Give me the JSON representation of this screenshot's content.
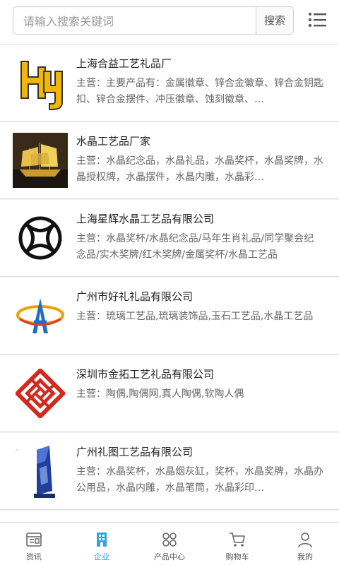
{
  "search": {
    "placeholder": "请输入搜索关键词",
    "button_label": "搜索"
  },
  "companies": [
    {
      "name": "上海合益工艺礼品厂",
      "desc": "主营：主要产品有：金属徽章、锌合金徽章、锌合金钥匙扣、锌合金摆件、冲压徽章、蚀刻徽章、…"
    },
    {
      "name": "水晶工艺品厂家",
      "desc": "主营：水晶纪念品，水晶礼品，水晶奖杯，水晶奖牌，水晶授权牌，水晶摆件，水晶内雕，水晶彩…"
    },
    {
      "name": "上海星辉水晶工艺品有限公司",
      "desc": "主营：水晶奖杯/水晶纪念品/马年生肖礼品/同学聚会纪念品/实木奖牌/红木奖牌/金属奖杯/水晶工艺品"
    },
    {
      "name": "广州市好礼礼品有限公司",
      "desc": "主营：琉璃工艺品,琉璃装饰品,玉石工艺品,水晶工艺品"
    },
    {
      "name": "深圳市金拓工艺礼品有限公司",
      "desc": "主营：陶偶,陶偶网,真人陶偶,软陶人偶"
    },
    {
      "name": "广州礼图工艺品有限公司",
      "desc": "主营：水晶奖杯，水晶烟灰缸，奖杯，水晶奖牌，水晶办公用品，水晶内雕，水晶笔筒，水晶彩印…"
    }
  ],
  "tabs": [
    {
      "label": "资讯",
      "icon": "news-icon",
      "active": false
    },
    {
      "label": "企业",
      "icon": "building-icon",
      "active": true
    },
    {
      "label": "产品中心",
      "icon": "grid-icon",
      "active": false
    },
    {
      "label": "购物车",
      "icon": "cart-icon",
      "active": false
    },
    {
      "label": "我的",
      "icon": "user-icon",
      "active": false
    }
  ],
  "colors": {
    "accent": "#2ea7e0",
    "divider": "#dcdcdc",
    "text": "#222222",
    "muted": "#666666"
  }
}
